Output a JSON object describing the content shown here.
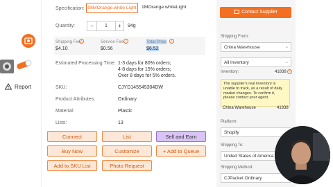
{
  "left": {
    "report_label": "Report"
  },
  "spec": {
    "label": "Specification:",
    "options": [
      "08MOrange.white Light",
      "1MOrange.whiteLight"
    ]
  },
  "quantity": {
    "label": "Quantity:",
    "minus": "−",
    "value": "1",
    "plus": "+",
    "weight": "94g"
  },
  "fees": {
    "shipping_label": "Shipping Fee",
    "shipping_value": "$4.10",
    "service_label": "Service Fee",
    "service_value": "$0.56",
    "total_label": "Total Price",
    "total_value": "$6.52"
  },
  "processing": {
    "label": "Estimated Processing Time:",
    "lines": [
      "1-3 days for 80% orders;",
      "4-8 days for 15% orders;",
      "Over 8 days for 5% orders."
    ]
  },
  "details": [
    {
      "label": "SKU:",
      "value": "CJYD145545304DW"
    },
    {
      "label": "Product Attributes:",
      "value": "Ordinary"
    },
    {
      "label": "Material:",
      "value": "Plastic"
    },
    {
      "label": "Lists:",
      "value": "13"
    }
  ],
  "buttons": {
    "connect": "Connect",
    "list": "List",
    "sell_and_earn": "Sell and Earn",
    "buy_now": "Buy Now",
    "customize": "Customize",
    "add_to_queue": "+ Add to Queue",
    "add_to_sku_list": "Add to SKU List",
    "photo_request": "Photo Request"
  },
  "right": {
    "contact_supplier": "Contact Supplier",
    "shipping_from_label": "Shipping From:",
    "shipping_from_value": "China Warehouse",
    "inventory_select": "All Inventory",
    "inventory_label": "Inventory:",
    "inventory_count": "41838",
    "tooltip": "The supplier's real inventory is unable to track, as a result of daily market changes. To confirm it, please contact your agent.",
    "warehouse_name": "China Warehouse",
    "warehouse_count": "41838",
    "platform_label": "Platform:",
    "platform_value": "Shopify",
    "shipping_to_label": "Shipping To:",
    "shipping_to_value": "United States of America",
    "shipping_method_label": "Shipping Method:",
    "shipping_method_value": "CJPacket Ordinary"
  },
  "colors": {
    "accent": "#f36f21",
    "button_bg": "#fde7d6",
    "purple": "#d9c4f5"
  }
}
